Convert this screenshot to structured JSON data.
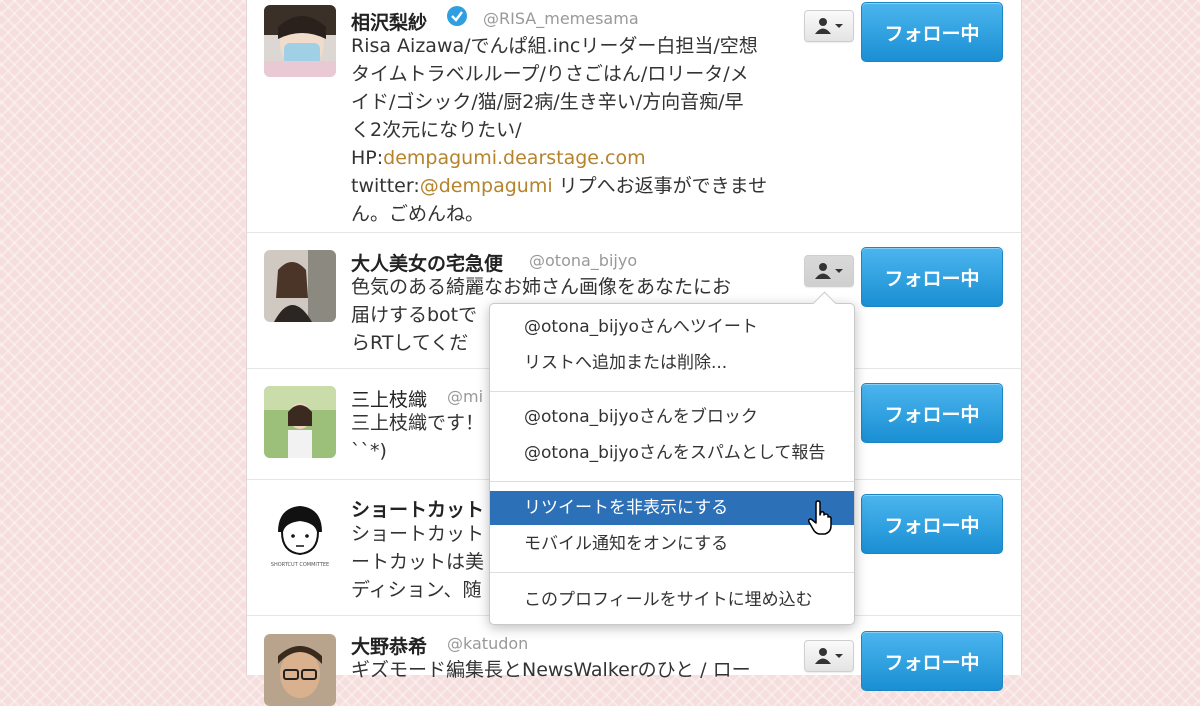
{
  "users": [
    {
      "name": "相沢梨紗",
      "handle": "@RISA_memesama",
      "verified": true,
      "bio_lines": [
        "Risa Aizawa/でんぱ組.incリーダー白担当/空想",
        "タイムトラベルループ/りさごはん/ロリータ/メ",
        "イド/ゴシック/猫/厨2病/生き辛い/方向音痴/早",
        "く2次元になりたい/"
      ],
      "hp_prefix": "HP:",
      "hp_link": "dempagumi.dearstage.com",
      "twitter_prefix": "twitter:",
      "twitter_link": "@dempagumi",
      "twitter_suffix": " リプへお返事ができませ",
      "last_line": "ん。ごめんね。",
      "follow_label": "フォロー中"
    },
    {
      "name": "大人美女の宅急便",
      "handle": "@otona_bijyo",
      "bio_lines": [
        "色気のある綺麗なお姉さん画像をあなたにお",
        "届けするbotで",
        "らRTしてくだ"
      ],
      "follow_label": "フォロー中"
    },
    {
      "name": "三上枝織",
      "handle": "@mi",
      "bio_lines": [
        "三上枝織です！",
        "``*)"
      ],
      "follow_label": "フォロー中"
    },
    {
      "name": "ショートカット",
      "bio_lines": [
        "ショートカット",
        "ートカットは美",
        "ディション、随"
      ],
      "avatar_caption": "SHORTCUT COMMITTEE",
      "follow_label": "フォロー中"
    },
    {
      "name": "大野恭希",
      "handle": "@katudon",
      "bio_lines": [
        "ギズモード編集長とNewsWalkerのひと / ロー"
      ],
      "follow_label": "フォロー中"
    }
  ],
  "dropdown": {
    "items": [
      "@otona_bijyoさんへツイート",
      "リストへ追加または削除...",
      "@otona_bijyoさんをブロック",
      "@otona_bijyoさんをスパムとして報告",
      "リツイートを非表示にする",
      "モバイル通知をオンにする",
      "このプロフィールをサイトに埋め込む"
    ],
    "highlighted_index": 4
  },
  "colors": {
    "follow_button": "#1a8fd3",
    "highlight": "#2c70b8",
    "link": "#b5832c",
    "verified": "#2f9fe2",
    "background": "#f6dede"
  },
  "icons": [
    "person-menu-icon",
    "verified-badge-icon",
    "hand-cursor-icon"
  ]
}
